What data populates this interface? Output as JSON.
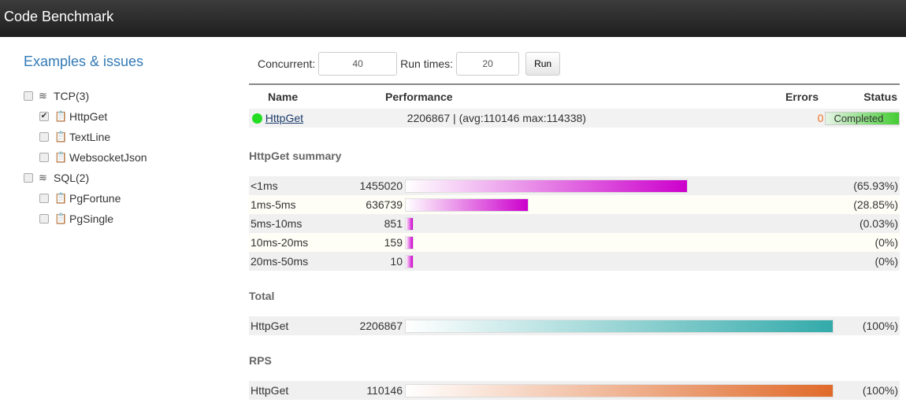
{
  "app": {
    "title": "Code Benchmark"
  },
  "sidebar": {
    "title": "Examples & issues",
    "groups": [
      {
        "label": "TCP(3)",
        "checked": false,
        "items": [
          {
            "label": "HttpGet",
            "checked": true
          },
          {
            "label": "TextLine",
            "checked": false
          },
          {
            "label": "WebsocketJson",
            "checked": false
          }
        ]
      },
      {
        "label": "SQL(2)",
        "checked": false,
        "items": [
          {
            "label": "PgFortune",
            "checked": false
          },
          {
            "label": "PgSingle",
            "checked": false
          }
        ]
      }
    ]
  },
  "controls": {
    "concurrent_label": "Concurrent:",
    "concurrent_value": "40",
    "runtimes_label": "Run times:",
    "runtimes_value": "20",
    "run_label": "Run"
  },
  "results": {
    "headers": [
      "Name",
      "Performance",
      "Errors",
      "Status"
    ],
    "rows": [
      {
        "name": "HttpGet",
        "performance": "2206867 | (avg:110146 max:114338)",
        "errors": "0",
        "status": "Completed"
      }
    ]
  },
  "sections": [
    {
      "title": "HttpGet summary",
      "color": "#cc00cc",
      "rows": [
        {
          "label": "<1ms",
          "value": "1455020",
          "percent": 65.93,
          "pct_text": "(65.93%)"
        },
        {
          "label": "1ms-5ms",
          "value": "636739",
          "percent": 28.85,
          "pct_text": "(28.85%)"
        },
        {
          "label": "5ms-10ms",
          "value": "851",
          "percent": 0.03,
          "pct_text": "(0.03%)"
        },
        {
          "label": "10ms-20ms",
          "value": "159",
          "percent": 0,
          "pct_text": "(0%)"
        },
        {
          "label": "20ms-50ms",
          "value": "10",
          "percent": 0,
          "pct_text": "(0%)"
        }
      ]
    },
    {
      "title": "Total",
      "color": "#33aaaa",
      "rows": [
        {
          "label": "HttpGet",
          "value": "2206867",
          "percent": 100,
          "pct_text": "(100%)"
        }
      ]
    },
    {
      "title": "RPS",
      "color": "#e06a2a",
      "rows": [
        {
          "label": "HttpGet",
          "value": "110146",
          "percent": 100,
          "pct_text": "(100%)"
        }
      ]
    }
  ]
}
